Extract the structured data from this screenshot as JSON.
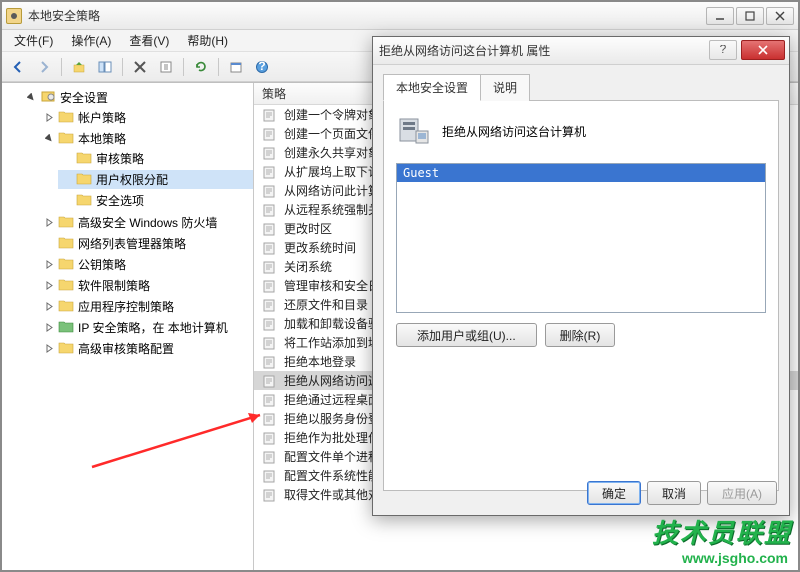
{
  "window": {
    "title": "本地安全策略"
  },
  "menus": {
    "file": "文件(F)",
    "action": "操作(A)",
    "view": "查看(V)",
    "help": "帮助(H)"
  },
  "tree": {
    "root": "安全设置",
    "items": [
      {
        "label": "帐户策略"
      },
      {
        "label": "本地策略",
        "children": [
          {
            "label": "审核策略"
          },
          {
            "label": "用户权限分配",
            "selected": true
          },
          {
            "label": "安全选项"
          }
        ]
      },
      {
        "label": "高级安全 Windows 防火墙"
      },
      {
        "label": "网络列表管理器策略",
        "leaf": true
      },
      {
        "label": "公钥策略"
      },
      {
        "label": "软件限制策略"
      },
      {
        "label": "应用程序控制策略"
      },
      {
        "label": "IP 安全策略，在 本地计算机",
        "green": true
      },
      {
        "label": "高级审核策略配置"
      }
    ]
  },
  "list": {
    "header": "策略",
    "rows": [
      "创建一个令牌对象",
      "创建一个页面文件",
      "创建永久共享对象",
      "从扩展坞上取下计算机",
      "从网络访问此计算机",
      "从远程系统强制关机",
      "更改时区",
      "更改系统时间",
      "关闭系统",
      "管理审核和安全日志",
      "还原文件和目录",
      "加载和卸载设备驱动程序",
      "将工作站添加到域",
      "拒绝本地登录",
      "拒绝从网络访问这台计算机",
      "拒绝通过远程桌面服务登录",
      "拒绝以服务身份登录",
      "拒绝作为批处理作业登录",
      "配置文件单个进程",
      "配置文件系统性能",
      "取得文件或其他对象的所有权"
    ],
    "selected_index": 14
  },
  "dialog": {
    "title": "拒绝从网络访问这台计算机 属性",
    "tabs": {
      "local": "本地安全设置",
      "explain": "说明"
    },
    "policy_name": "拒绝从网络访问这台计算机",
    "items": [
      "Guest"
    ],
    "buttons": {
      "add": "添加用户或组(U)...",
      "remove": "删除(R)",
      "ok": "确定",
      "cancel": "取消",
      "apply": "应用(A)"
    }
  },
  "watermark": {
    "line1": "技术员联盟",
    "line2": "www.jsgho.com"
  }
}
